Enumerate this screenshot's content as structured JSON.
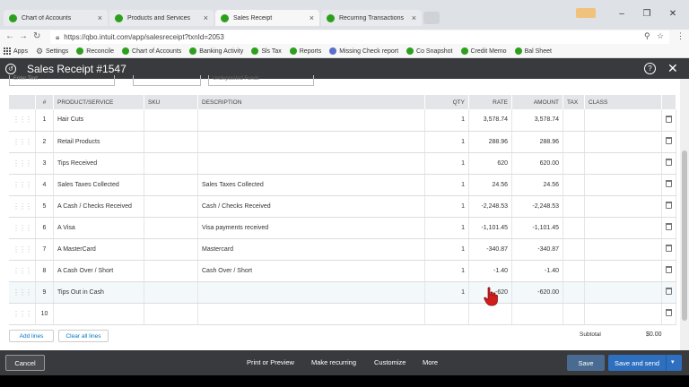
{
  "browser": {
    "tabs": [
      {
        "title": "Chart of Accounts",
        "active": false
      },
      {
        "title": "Products and Services",
        "active": false
      },
      {
        "title": "Sales Receipt",
        "active": true
      },
      {
        "title": "Recurring Transactions",
        "active": false
      }
    ],
    "close_glyph": "×",
    "window_controls": {
      "minimize": "–",
      "maximize": "❐",
      "close": "✕"
    },
    "badge_text": "",
    "url": "https://qbo.intuit.com/app/salesreceipt?txnId=2053",
    "bookmarks": [
      {
        "label": "Apps",
        "icon": "apps-grid-icon"
      },
      {
        "label": "Settings",
        "icon": "gear-icon"
      },
      {
        "label": "Reconcile",
        "icon": "qb-icon"
      },
      {
        "label": "Chart of Accounts",
        "icon": "qb-icon"
      },
      {
        "label": "Banking Activity",
        "icon": "qb-icon"
      },
      {
        "label": "Sls Tax",
        "icon": "qb-icon"
      },
      {
        "label": "Reports",
        "icon": "qb-icon"
      },
      {
        "label": "Missing Check report",
        "icon": "globe-icon"
      },
      {
        "label": "Co Snapshot",
        "icon": "qb-icon"
      },
      {
        "label": "Credit Memo",
        "icon": "qb-icon"
      },
      {
        "label": "Bal Sheet",
        "icon": "qb-icon"
      }
    ]
  },
  "header": {
    "title": "Sales Receipt #1547",
    "help_glyph": "?",
    "close_glyph": "✕"
  },
  "top_fields": {
    "field1_placeholder": "Enter Text",
    "field3_value": "Undeposited Funds"
  },
  "table": {
    "columns": [
      "#",
      "PRODUCT/SERVICE",
      "SKU",
      "DESCRIPTION",
      "QTY",
      "RATE",
      "AMOUNT",
      "TAX",
      "CLASS"
    ],
    "rows": [
      {
        "n": "1",
        "product": "Hair Cuts",
        "sku": "",
        "desc": "",
        "qty": "1",
        "rate": "3,578.74",
        "amount": "3,578.74"
      },
      {
        "n": "2",
        "product": "Retail Products",
        "sku": "",
        "desc": "",
        "qty": "1",
        "rate": "288.96",
        "amount": "288.96"
      },
      {
        "n": "3",
        "product": "Tips Received",
        "sku": "",
        "desc": "",
        "qty": "1",
        "rate": "620",
        "amount": "620.00"
      },
      {
        "n": "4",
        "product": "Sales Taxes Collected",
        "sku": "",
        "desc": "Sales Taxes Collected",
        "qty": "1",
        "rate": "24.56",
        "amount": "24.56"
      },
      {
        "n": "5",
        "product": "A Cash / Checks Received",
        "sku": "",
        "desc": "Cash / Checks Received",
        "qty": "1",
        "rate": "-2,248.53",
        "amount": "-2,248.53"
      },
      {
        "n": "6",
        "product": "A Visa",
        "sku": "",
        "desc": "Visa payments received",
        "qty": "1",
        "rate": "-1,101.45",
        "amount": "-1,101.45"
      },
      {
        "n": "7",
        "product": "A MasterCard",
        "sku": "",
        "desc": "Mastercard",
        "qty": "1",
        "rate": "-340.87",
        "amount": "-340.87"
      },
      {
        "n": "8",
        "product": "A Cash Over / Short",
        "sku": "",
        "desc": "Cash Over / Short",
        "qty": "1",
        "rate": "-1.40",
        "amount": "-1.40"
      },
      {
        "n": "9",
        "product": "Tips Out in Cash",
        "sku": "",
        "desc": "",
        "qty": "1",
        "rate": "-620",
        "amount": "-620.00"
      },
      {
        "n": "10",
        "product": "",
        "sku": "",
        "desc": "",
        "qty": "",
        "rate": "",
        "amount": ""
      }
    ]
  },
  "actions": {
    "add_lines": "Add lines",
    "clear_all_lines": "Clear all lines",
    "subtotal_label": "Subtotal",
    "subtotal_value": "$0.00"
  },
  "footer": {
    "cancel": "Cancel",
    "print_preview": "Print or Preview",
    "make_recurring": "Make recurring",
    "customize": "Customize",
    "more": "More",
    "save": "Save",
    "save_and_send": "Save and send"
  },
  "colors": {
    "qb_green": "#2ca01c",
    "header_bg": "#393a3d",
    "primary_blue": "#2e6fbf",
    "cursor_red": "#d21d1d"
  }
}
